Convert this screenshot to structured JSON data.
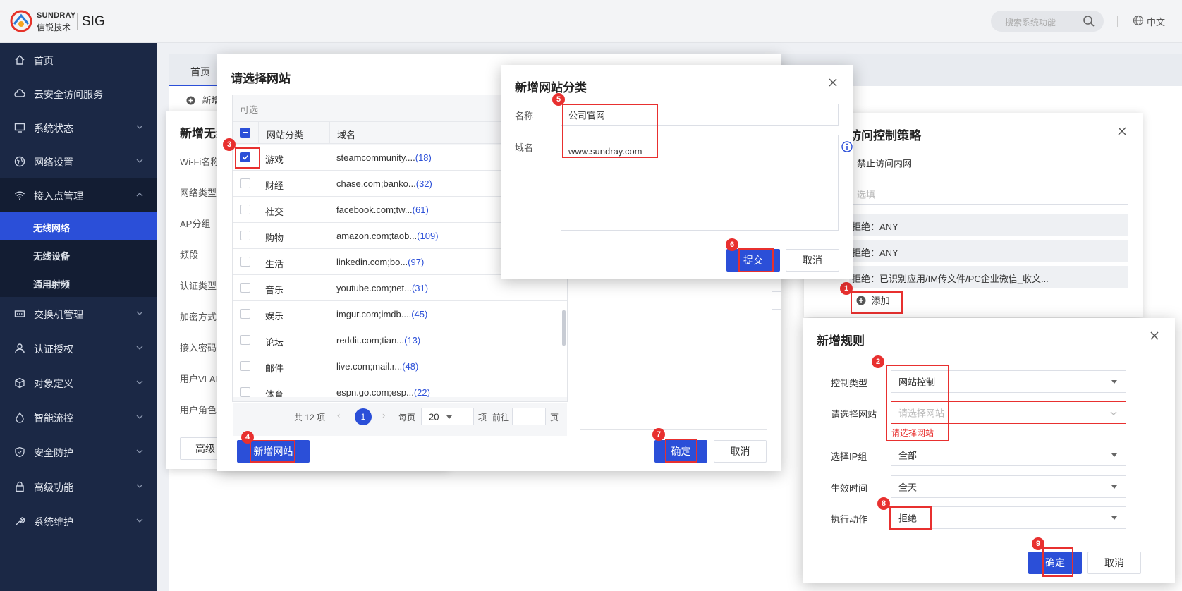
{
  "app": {
    "brand_en": "SUNDRAY",
    "brand_cn": "信锐技术",
    "product": "SIG"
  },
  "header": {
    "search_placeholder": "搜索系统功能",
    "language": "中文"
  },
  "sidebar": {
    "items": [
      {
        "label": "首页",
        "icon": "home-icon"
      },
      {
        "label": "云安全访问服务",
        "icon": "cloud-icon"
      },
      {
        "label": "系统状态",
        "icon": "monitor-icon"
      },
      {
        "label": "网络设置",
        "icon": "globe-icon"
      },
      {
        "label": "接入点管理",
        "icon": "wifi-icon"
      },
      {
        "label": "交换机管理",
        "icon": "switch-icon"
      },
      {
        "label": "认证授权",
        "icon": "user-icon"
      },
      {
        "label": "对象定义",
        "icon": "cube-icon"
      },
      {
        "label": "智能流控",
        "icon": "flame-icon"
      },
      {
        "label": "安全防护",
        "icon": "shield-icon"
      },
      {
        "label": "高级功能",
        "icon": "lock-icon"
      },
      {
        "label": "系统维护",
        "icon": "wrench-icon"
      }
    ],
    "subitems": [
      "无线网络",
      "无线设备",
      "通用射频"
    ]
  },
  "main": {
    "tab_home": "首页",
    "add_label": "新增"
  },
  "wifi_panel": {
    "title": "新增无线",
    "labels": [
      "Wi-Fi名称",
      "网络类型",
      "AP分组",
      "频段",
      "认证类型",
      "加密方式",
      "接入密码",
      "用户VLAN",
      "用户角色"
    ],
    "advanced": "高级"
  },
  "policy_panel": {
    "title": "访问控制策略",
    "name_value": "禁止访问内网",
    "desc_placeholder": "选填",
    "rules": [
      "拒绝：ANY",
      "拒绝：ANY",
      "拒绝：已识别应用/IM传文件/PC企业微信_收文..."
    ],
    "add_button": "添加"
  },
  "select_site": {
    "title": "请选择网站",
    "available_label": "可选",
    "col_category": "网站分类",
    "col_domain": "域名",
    "rows": [
      {
        "category": "游戏",
        "domain": "steamcommunity....",
        "count": "(18)",
        "checked": true
      },
      {
        "category": "财经",
        "domain": "chase.com;banko...",
        "count": "(32)",
        "checked": false
      },
      {
        "category": "社交",
        "domain": "facebook.com;tw...",
        "count": "(61)",
        "checked": false
      },
      {
        "category": "购物",
        "domain": "amazon.com;taob...",
        "count": "(109)",
        "checked": false
      },
      {
        "category": "生活",
        "domain": "linkedin.com;bo...",
        "count": "(97)",
        "checked": false
      },
      {
        "category": "音乐",
        "domain": "youtube.com;net...",
        "count": "(31)",
        "checked": false
      },
      {
        "category": "娱乐",
        "domain": "imgur.com;imdb....",
        "count": "(45)",
        "checked": false
      },
      {
        "category": "论坛",
        "domain": "reddit.com;tian...",
        "count": "(13)",
        "checked": false
      },
      {
        "category": "邮件",
        "domain": "live.com;mail.r...",
        "count": "(48)",
        "checked": false
      },
      {
        "category": "体育",
        "domain": "espn.go.com;esp...",
        "count": "(22)",
        "checked": false
      }
    ],
    "pagination": {
      "total": "共 12 项",
      "current": "1",
      "per_page_label": "每页",
      "per_page": "20",
      "unit": "项",
      "goto": "前往",
      "page_unit": "页"
    },
    "add_site_button": "新增网站",
    "ok": "确定",
    "cancel": "取消"
  },
  "new_category": {
    "title": "新增网站分类",
    "name_label": "名称",
    "name_value": "公司官网",
    "domain_label": "域名",
    "domain_value": "www.sundray.com",
    "submit": "提交",
    "cancel": "取消"
  },
  "new_rule": {
    "title": "新增规则",
    "control_type_label": "控制类型",
    "control_type": "网站控制",
    "site_label": "请选择网站",
    "site_placeholder": "请选择网站",
    "site_error": "请选择网站",
    "ip_group_label": "选择IP组",
    "ip_group": "全部",
    "time_label": "生效时间",
    "time": "全天",
    "action_label": "执行动作",
    "action": "拒绝",
    "ok": "确定",
    "cancel": "取消"
  },
  "steps": [
    "1",
    "2",
    "3",
    "4",
    "5",
    "6",
    "7",
    "8",
    "9"
  ],
  "colors": {
    "primary": "#2b4fd8",
    "sidebar": "#1b2845",
    "highlight": "#e8302f"
  }
}
